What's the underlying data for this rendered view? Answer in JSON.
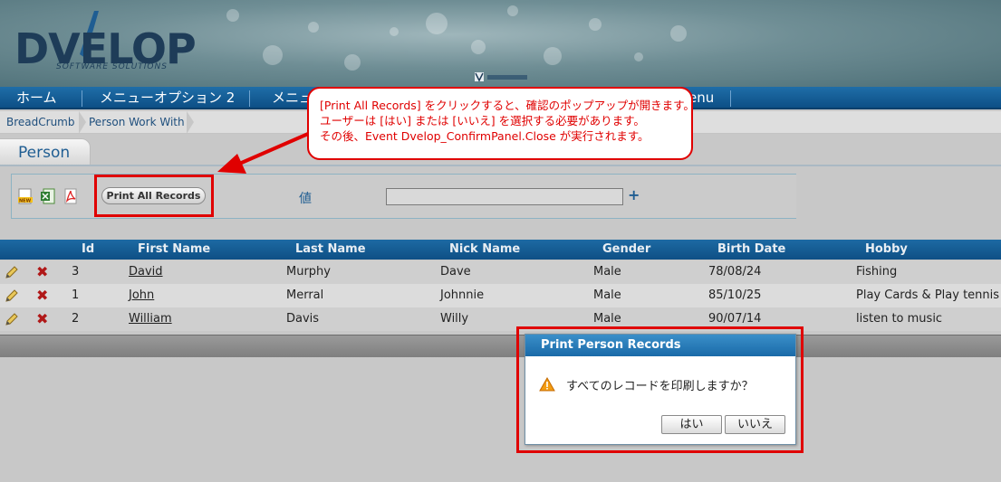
{
  "header": {
    "logo_text": "DVELOP",
    "logo_subtitle": "SOFTWARE SOLUTIONS"
  },
  "nav": {
    "items": [
      {
        "label": "ホーム"
      },
      {
        "label": "メニューオプション 2"
      },
      {
        "label": "メニュー"
      },
      {
        "label": "enu"
      }
    ]
  },
  "breadcrumb": {
    "items": [
      "BreadCrumb",
      "Person Work With"
    ]
  },
  "tab": {
    "label": "Person"
  },
  "form": {
    "print_all_label": "Print All Records",
    "value_label": "値",
    "value_input": "",
    "add_icon": "+"
  },
  "grid": {
    "columns": [
      "Id",
      "First Name",
      "Last Name",
      "Nick Name",
      "Gender",
      "Birth Date",
      "Hobby"
    ],
    "rows": [
      {
        "id": "3",
        "first": "David",
        "last": "Murphy",
        "nick": "Dave",
        "gender": "Male",
        "birth": "78/08/24",
        "hobby": "Fishing"
      },
      {
        "id": "1",
        "first": "John",
        "last": "Merral",
        "nick": "Johnnie",
        "gender": "Male",
        "birth": "85/10/25",
        "hobby": "Play Cards & Play tennis"
      },
      {
        "id": "2",
        "first": "William",
        "last": "Davis",
        "nick": "Willy",
        "gender": "Male",
        "birth": "90/07/14",
        "hobby": "listen to music"
      }
    ],
    "row_icons": {
      "edit": "pencil-icon",
      "delete": "x-icon"
    }
  },
  "callout": {
    "lines": [
      "[Print All Records] をクリックすると、確認のポップアップが開きます。",
      "ユーザーは [はい] または [いいえ] を選択する必要があります。",
      "その後、Event Dvelop_ConfirmPanel.Close が実行されます。"
    ]
  },
  "modal": {
    "title": "Print Person Records",
    "message": "すべてのレコードを印刷しますか？",
    "yes_label": "はい",
    "no_label": "いいえ",
    "icon": "warning-icon"
  },
  "colors": {
    "nav_bg": "#1560a0",
    "annotation_red": "#e00000",
    "modal_title_bg": "#2a7dbb",
    "row_alt": "#dcdcdc"
  }
}
